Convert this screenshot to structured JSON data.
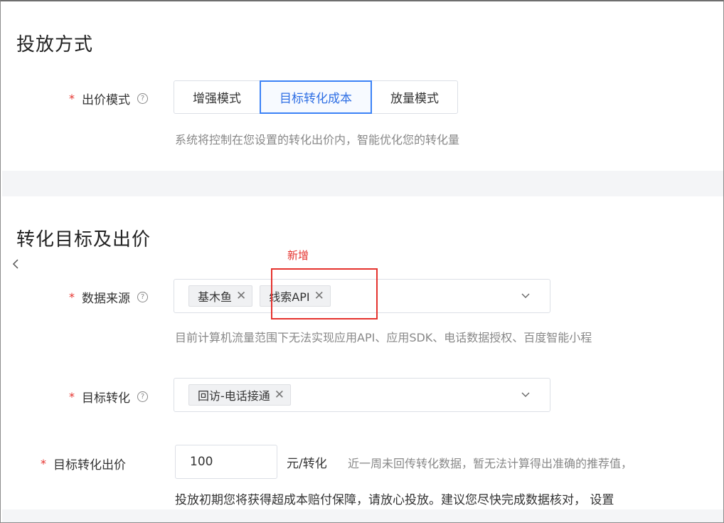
{
  "delivery": {
    "title": "投放方式",
    "bid_mode": {
      "label": "出价模式",
      "options": [
        "增强模式",
        "目标转化成本",
        "放量模式"
      ],
      "selected": "目标转化成本",
      "hint": "系统将控制在您设置的转化出价内，智能优化您的转化量"
    }
  },
  "conversion": {
    "title": "转化目标及出价",
    "annotation": "新增",
    "data_source": {
      "label": "数据来源",
      "tags": [
        "基木鱼",
        "线索API"
      ],
      "hint": "目前计算机流量范围下无法实现应用API、应用SDK、电话数据授权、百度智能小程"
    },
    "target": {
      "label": "目标转化",
      "tags": [
        "回访-电话接通"
      ]
    },
    "bid": {
      "label": "目标转化出价",
      "value": "100",
      "unit": "元/转化",
      "unit_hint": "近一周未回传转化数据，暂无法计算得出准确的推荐值，",
      "guarantee": "投放初期您将获得超成本赔付保障，请放心投放。建议您尽快完成数据核对， 设置"
    }
  },
  "icons": {
    "help": "?",
    "close": "✕"
  },
  "colors": {
    "accent": "#3b82f6",
    "required": "#e5322d",
    "highlight": "#e5322d"
  }
}
